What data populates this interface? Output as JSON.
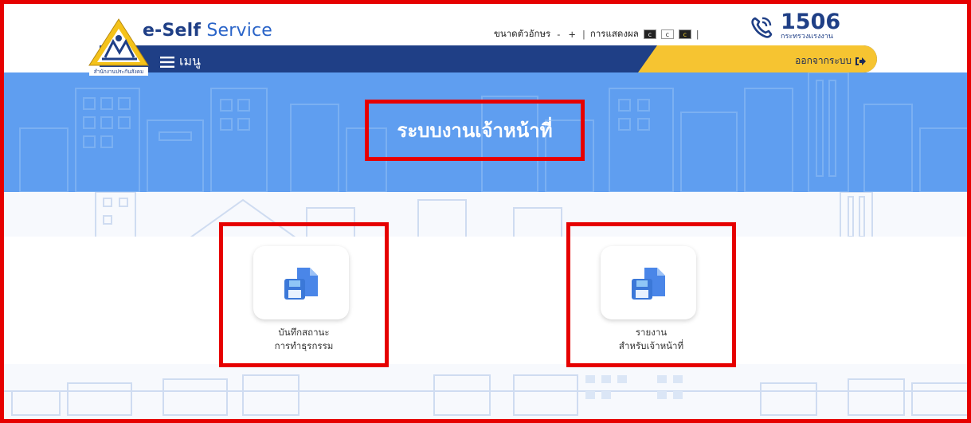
{
  "brand": {
    "bold": "e-Self",
    "light": " Service",
    "logo_caption": "สำนักงานประกันสังคม"
  },
  "toolbar": {
    "font_size_label": "ขนาดตัวอักษร",
    "font_minus": "-",
    "font_plus": "+",
    "sep": "|",
    "display_label": "การแสดงผล",
    "contrast_chip": "c"
  },
  "hotline": {
    "number": "1506",
    "ministry": "กระทรวงแรงงาน"
  },
  "nav": {
    "menu_label": "เมนู",
    "logout_label": "ออกจากระบบ"
  },
  "hero": {
    "title": "ระบบงานเจ้าหน้าที่"
  },
  "cards": [
    {
      "line1": "บันทึกสถานะ",
      "line2": "การทำธุรกรรม"
    },
    {
      "line1": "รายงาน",
      "line2": "สำหรับเจ้าหน้าที่"
    }
  ],
  "colors": {
    "navy": "#1f3f86",
    "yellow": "#f6c431",
    "hero_blue": "#5f9ef0",
    "highlight_red": "#e60000"
  }
}
